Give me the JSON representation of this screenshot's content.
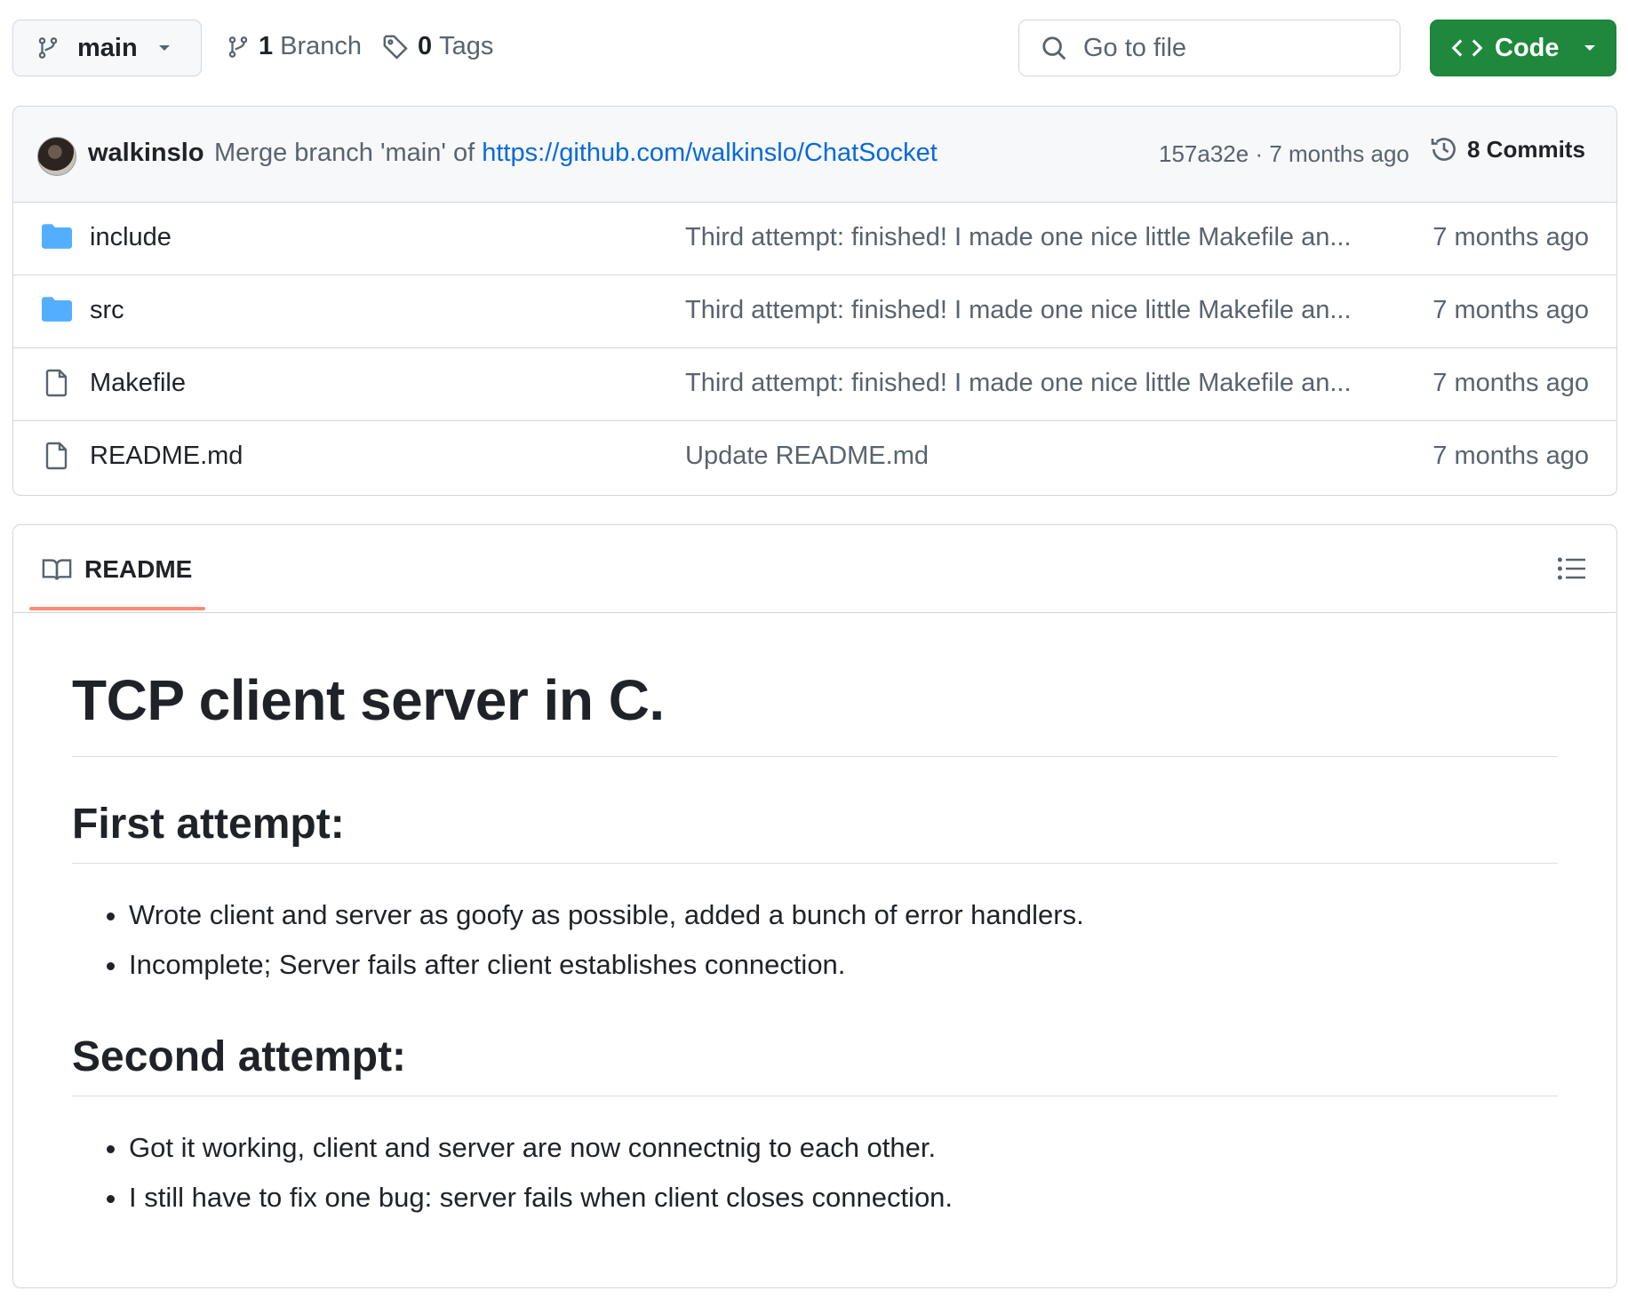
{
  "toolbar": {
    "branch": "main",
    "branch_count": "1",
    "branch_label": "Branch",
    "tag_count": "0",
    "tag_label": "Tags",
    "search_placeholder": "Go to file",
    "code_label": "Code"
  },
  "latest_commit": {
    "author": "walkinslo",
    "message": "Merge branch 'main' of",
    "link": "https://github.com/walkinslo/ChatSocket",
    "sha_time": "157a32e · 7 months ago",
    "commits_label": "8 Commits"
  },
  "files": [
    {
      "name": "include",
      "type": "folder",
      "message": "Third attempt: finished! I made one nice little Makefile an...",
      "age": "7 months ago"
    },
    {
      "name": "src",
      "type": "folder",
      "message": "Third attempt: finished! I made one nice little Makefile an...",
      "age": "7 months ago"
    },
    {
      "name": "Makefile",
      "type": "file",
      "message": "Third attempt: finished! I made one nice little Makefile an...",
      "age": "7 months ago"
    },
    {
      "name": "README.md",
      "type": "file",
      "message": "Update README.md",
      "age": "7 months ago"
    }
  ],
  "readme": {
    "tab_label": "README",
    "title": "TCP client server in C.",
    "sections": [
      {
        "heading": "First attempt:",
        "items": [
          "Wrote client and server as goofy as possible, added a bunch of error handlers.",
          "Incomplete; Server fails after client establishes connection."
        ]
      },
      {
        "heading": "Second attempt:",
        "items": [
          "Got it working, client and server are now connectnig to each other.",
          "I still have to fix one bug: server fails when client closes connection."
        ]
      }
    ]
  },
  "colors": {
    "code_button": "#1f883d",
    "link": "#0969da",
    "folder": "#54aeff",
    "tab_underline": "#fd8c73"
  }
}
